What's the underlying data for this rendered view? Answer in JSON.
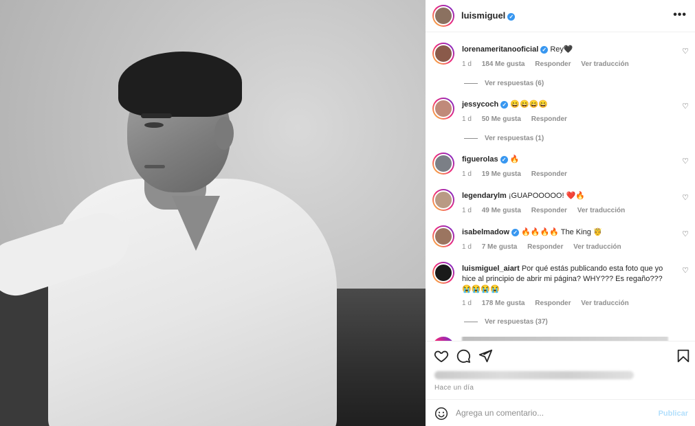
{
  "post": {
    "username": "luismiguel",
    "verified": true,
    "more_icon": "more-horizontal-icon",
    "photo_alt": "Black and white portrait"
  },
  "comments": [
    {
      "username": "lorenameritanooficial",
      "verified": true,
      "text": "Rey",
      "emoji": "🖤",
      "time": "1 d",
      "likes": "184 Me gusta",
      "reply": "Responder",
      "translate": "Ver traducción",
      "replies": "Ver respuestas (6)",
      "avatar_color": "#8a5a4a"
    },
    {
      "username": "jessycoch",
      "verified": true,
      "text": "",
      "emoji": "😄😄😄😄",
      "time": "1 d",
      "likes": "50 Me gusta",
      "reply": "Responder",
      "translate": "",
      "replies": "Ver respuestas (1)",
      "avatar_color": "#c08a7a"
    },
    {
      "username": "figuerolas",
      "verified": true,
      "text": "",
      "emoji": "🔥",
      "time": "1 d",
      "likes": "19 Me gusta",
      "reply": "Responder",
      "translate": "",
      "replies": "",
      "avatar_color": "#7b7f86"
    },
    {
      "username": "legendarylm",
      "verified": false,
      "text": "¡GUAPOOOOO!",
      "emoji": "❤️🔥",
      "time": "1 d",
      "likes": "49 Me gusta",
      "reply": "Responder",
      "translate": "Ver traducción",
      "replies": "",
      "avatar_color": "#b99a84"
    },
    {
      "username": "isabelmadow",
      "verified": true,
      "text": "The King",
      "emoji_before": "🔥🔥🔥🔥",
      "emoji": "🤴",
      "time": "1 d",
      "likes": "7 Me gusta",
      "reply": "Responder",
      "translate": "Ver traducción",
      "replies": "",
      "avatar_color": "#9b7560"
    },
    {
      "username": "luismiguel_aiart",
      "verified": false,
      "text": "Por qué estás publicando esta foto que yo hice al principio de abrir mi página? WHY??? Es regaño???",
      "emoji": "😭😭😭😭",
      "time": "1 d",
      "likes": "178 Me gusta",
      "reply": "Responder",
      "translate": "Ver traducción",
      "replies": "Ver respuestas (37)",
      "avatar_color": "#1a1a1a"
    }
  ],
  "actions": {
    "like_icon": "heart-icon",
    "comment_icon": "comment-icon",
    "share_icon": "send-icon",
    "save_icon": "bookmark-icon"
  },
  "timestamp": "Hace un día",
  "add_comment": {
    "placeholder": "Agrega un comentario...",
    "post_label": "Publicar",
    "emoji_icon": "smile-icon"
  },
  "colors": {
    "verified": "#3897f0",
    "muted": "#8e8e8e",
    "text": "#262626",
    "post_disabled": "#b2dffc"
  }
}
